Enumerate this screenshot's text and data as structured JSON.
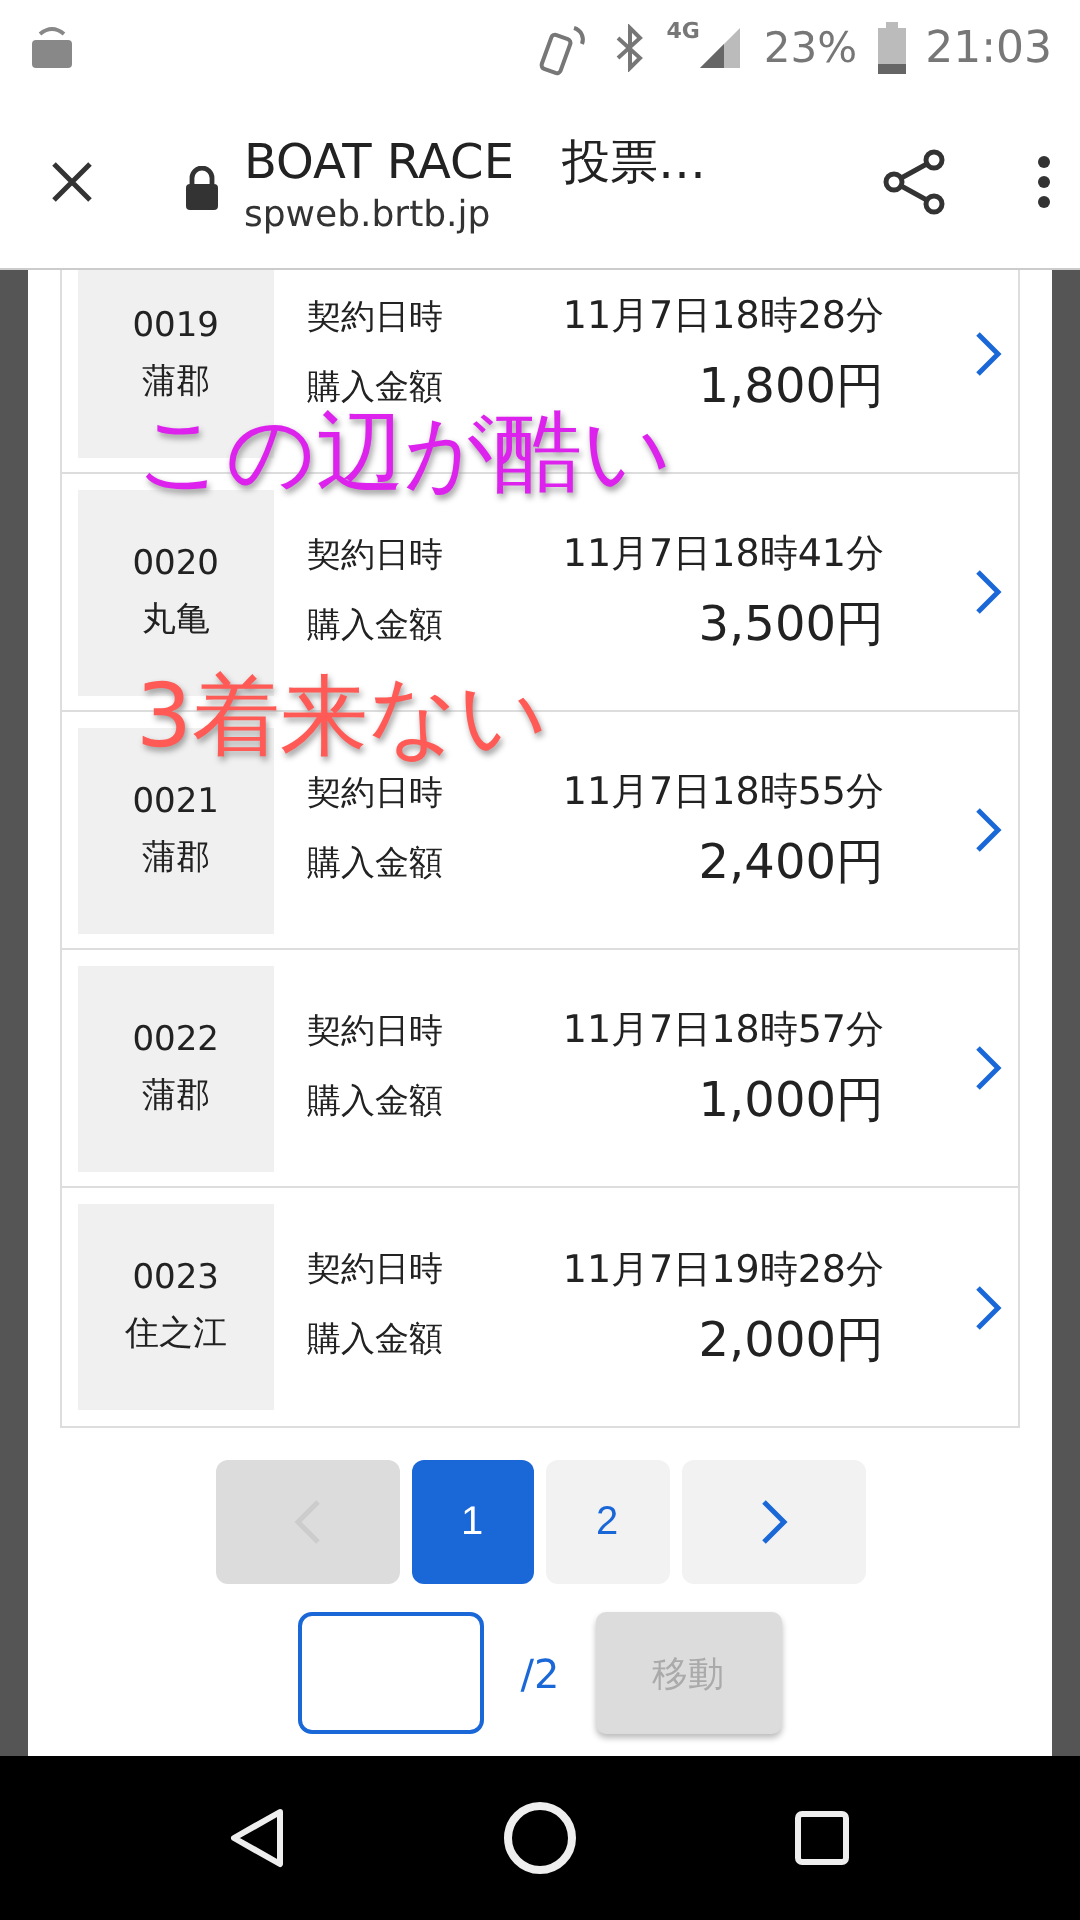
{
  "status_bar": {
    "network": "4G",
    "battery": "23%",
    "time": "21:03"
  },
  "browser": {
    "title": "BOAT RACE　投票…",
    "url": "spweb.brtb.jp"
  },
  "bets": [
    {
      "number": "0019",
      "venue": "蒲郡",
      "date_label": "契約日時",
      "date": "11月7日18時28分",
      "amount_label": "購入金額",
      "amount": "1,800円"
    },
    {
      "number": "0020",
      "venue": "丸亀",
      "date_label": "契約日時",
      "date": "11月7日18時41分",
      "amount_label": "購入金額",
      "amount": "3,500円"
    },
    {
      "number": "0021",
      "venue": "蒲郡",
      "date_label": "契約日時",
      "date": "11月7日18時55分",
      "amount_label": "購入金額",
      "amount": "2,400円"
    },
    {
      "number": "0022",
      "venue": "蒲郡",
      "date_label": "契約日時",
      "date": "11月7日18時57分",
      "amount_label": "購入金額",
      "amount": "1,000円"
    },
    {
      "number": "0023",
      "venue": "住之江",
      "date_label": "契約日時",
      "date": "11月7日19時28分",
      "amount_label": "購入金額",
      "amount": "2,000円"
    }
  ],
  "pagination": {
    "previous": {
      "disabled": true
    },
    "pages": [
      {
        "label": "1",
        "selected": true
      },
      {
        "label": "2",
        "selected": false
      }
    ],
    "next": {
      "disabled": false
    }
  },
  "page_jump": {
    "total": "/2",
    "button": "移動",
    "button_disabled": true
  },
  "annotations": [
    {
      "text": "この辺が酷い",
      "color": "#dd22ee"
    },
    {
      "text": "3着来ない",
      "color": "#ff5a55"
    }
  ]
}
